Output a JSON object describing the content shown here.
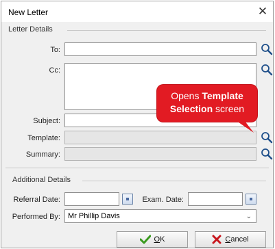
{
  "window": {
    "title": "New Letter"
  },
  "letter_details": {
    "heading": "Letter Details",
    "to": {
      "label": "To:",
      "value": ""
    },
    "cc": {
      "label": "Cc:",
      "value": ""
    },
    "subject": {
      "label": "Subject:",
      "value": ""
    },
    "template": {
      "label": "Template:",
      "value": ""
    },
    "summary": {
      "label": "Summary:",
      "value": ""
    }
  },
  "additional_details": {
    "heading": "Additional Details",
    "referral_date": {
      "label": "Referral Date:",
      "value": ""
    },
    "exam_date": {
      "label": "Exam. Date:",
      "value": ""
    },
    "performed_by": {
      "label": "Performed By:",
      "value": "Mr Phillip Davis"
    }
  },
  "buttons": {
    "ok": {
      "accel": "O",
      "rest": "K"
    },
    "cancel": {
      "accel": "C",
      "rest": "ancel"
    }
  },
  "callout": {
    "part1": "Opens ",
    "bold1": "Template",
    "bold2": "Selection",
    "part2": " screen"
  },
  "icons": {
    "close": "close-icon",
    "search": "magnifier-icon",
    "calendar": "calendar-icon",
    "ok": "checkmark-icon",
    "cancel": "x-mark-icon"
  },
  "colors": {
    "callout": "#e21b23",
    "ok_icon": "#3a9a1e",
    "cancel_icon": "#c8161d",
    "search_icon": "#1e4f8a"
  }
}
